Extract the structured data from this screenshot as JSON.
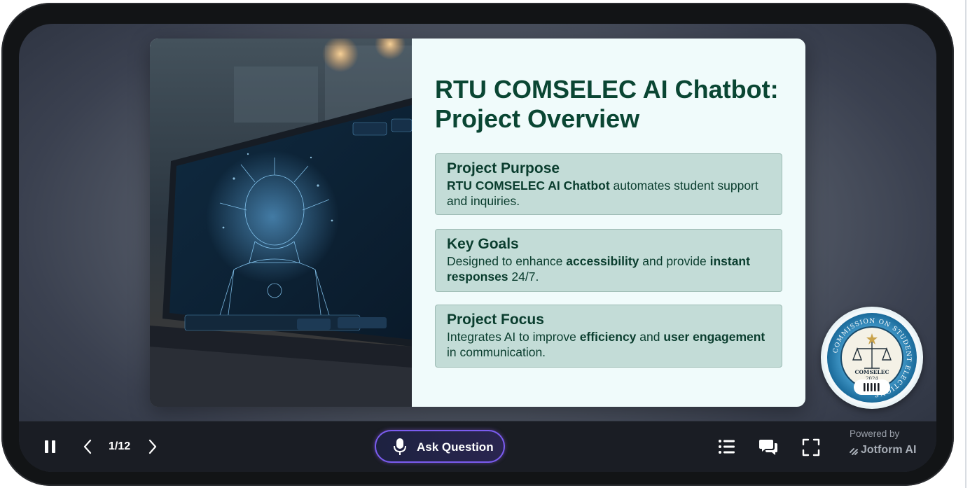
{
  "slide": {
    "title": "RTU COMSELEC AI Chatbot: Project Overview",
    "cards": [
      {
        "heading": "Project Purpose",
        "segments": [
          {
            "text": "RTU COMSELEC AI Chatbot",
            "bold": true
          },
          {
            "text": " automates student support and inquiries.",
            "bold": false
          }
        ]
      },
      {
        "heading": "Key Goals",
        "segments": [
          {
            "text": "Designed to enhance ",
            "bold": false
          },
          {
            "text": "accessibility",
            "bold": true
          },
          {
            "text": " and provide ",
            "bold": false
          },
          {
            "text": "instant responses",
            "bold": true
          },
          {
            "text": " 24/7.",
            "bold": false
          }
        ]
      },
      {
        "heading": "Project Focus",
        "segments": [
          {
            "text": "Integrates AI to improve ",
            "bold": false
          },
          {
            "text": "efficiency",
            "bold": true
          },
          {
            "text": " and ",
            "bold": false
          },
          {
            "text": "user engagement",
            "bold": true
          },
          {
            "text": " in communication.",
            "bold": false
          }
        ]
      }
    ]
  },
  "badge": {
    "ring_text": "COMMISSION ON STUDENT ELECTIONS",
    "center_text": "COMSELEC",
    "year": "2024",
    "voice_icon": "audio-bars-icon"
  },
  "controls": {
    "current_slide": "1/12",
    "pause_icon": "pause-icon",
    "prev_icon": "chevron-left-icon",
    "next_icon": "chevron-right-icon",
    "ask_label": "Ask Question",
    "mic_icon": "microphone-icon",
    "list_icon": "list-icon",
    "chat_icon": "chat-icon",
    "fullscreen_icon": "fullscreen-icon",
    "powered_by": "Powered by",
    "brand": "Jotform AI"
  },
  "colors": {
    "title": "#0a4633",
    "card_bg": "#c3dcd7",
    "ask_border": "#7b5cf0",
    "control_bar": "#1a1d24"
  }
}
